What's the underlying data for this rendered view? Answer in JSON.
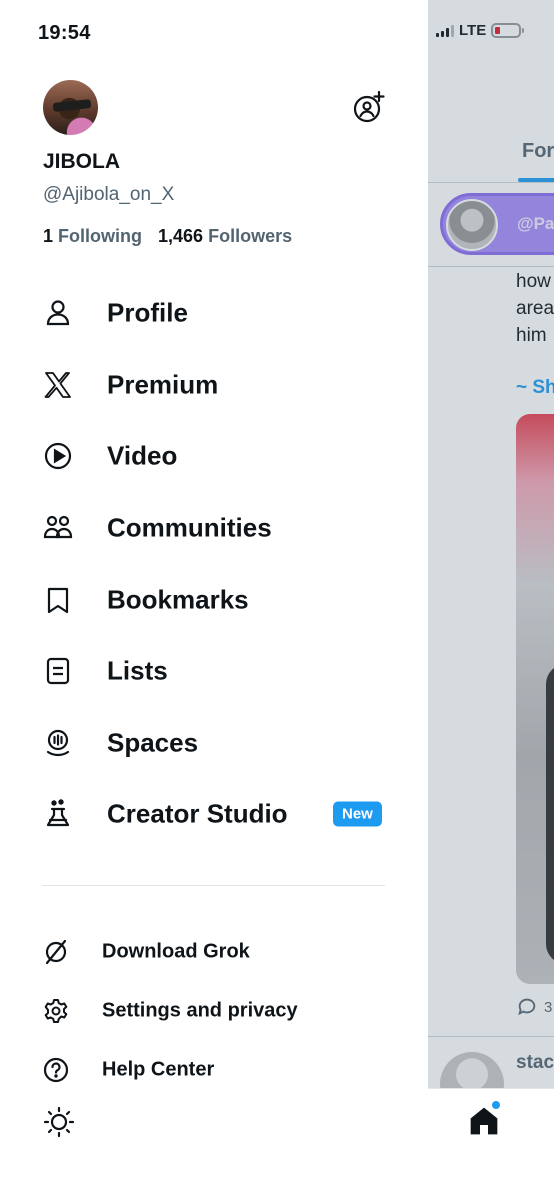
{
  "status_bar": {
    "time": "19:54",
    "network": "LTE"
  },
  "account": {
    "display_name": "JIBOLA",
    "handle": "@Ajibola_on_X",
    "following_count": "1",
    "following_label": "Following",
    "followers_count": "1,466",
    "followers_label": "Followers"
  },
  "menu": {
    "items": [
      {
        "label": "Profile",
        "icon": "person-icon"
      },
      {
        "label": "Premium",
        "icon": "x-logo-icon"
      },
      {
        "label": "Video",
        "icon": "play-circle-icon"
      },
      {
        "label": "Communities",
        "icon": "communities-icon"
      },
      {
        "label": "Bookmarks",
        "icon": "bookmark-icon"
      },
      {
        "label": "Lists",
        "icon": "list-icon"
      },
      {
        "label": "Spaces",
        "icon": "spaces-mic-icon"
      },
      {
        "label": "Creator Studio",
        "icon": "flask-icon",
        "badge": "New"
      }
    ]
  },
  "secondary_menu": {
    "items": [
      {
        "label": "Download Grok",
        "icon": "grok-icon"
      },
      {
        "label": "Settings and privacy",
        "icon": "gear-icon"
      },
      {
        "label": "Help Center",
        "icon": "help-icon"
      }
    ],
    "theme_icon": "sun-icon"
  },
  "timeline": {
    "tab_label": "For",
    "space_handle": "@Pa",
    "post_text": "how\narea\nhim",
    "link_text": "~ Sh",
    "reply_count": "3",
    "next_author": "stac"
  },
  "colors": {
    "accent": "#1d9bf0",
    "text_primary": "#0f1419",
    "text_secondary": "#536471",
    "spaces_purple": "#a78bfa",
    "battery_low": "#e0192a"
  }
}
